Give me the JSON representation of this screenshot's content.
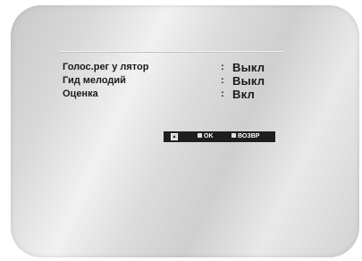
{
  "menu": {
    "items": [
      {
        "label": "Голос.рег у лятор",
        "separator": ":",
        "value": "Выкл"
      },
      {
        "label": "Гид мелодий",
        "separator": ":",
        "value": "Выкл"
      },
      {
        "label": "Оценка",
        "separator": ":",
        "value": "Вкл"
      }
    ]
  },
  "helpbar": {
    "move_icon": "navigation-pad-icon",
    "ok_label": "OK",
    "back_label": "ВОЗВР"
  }
}
